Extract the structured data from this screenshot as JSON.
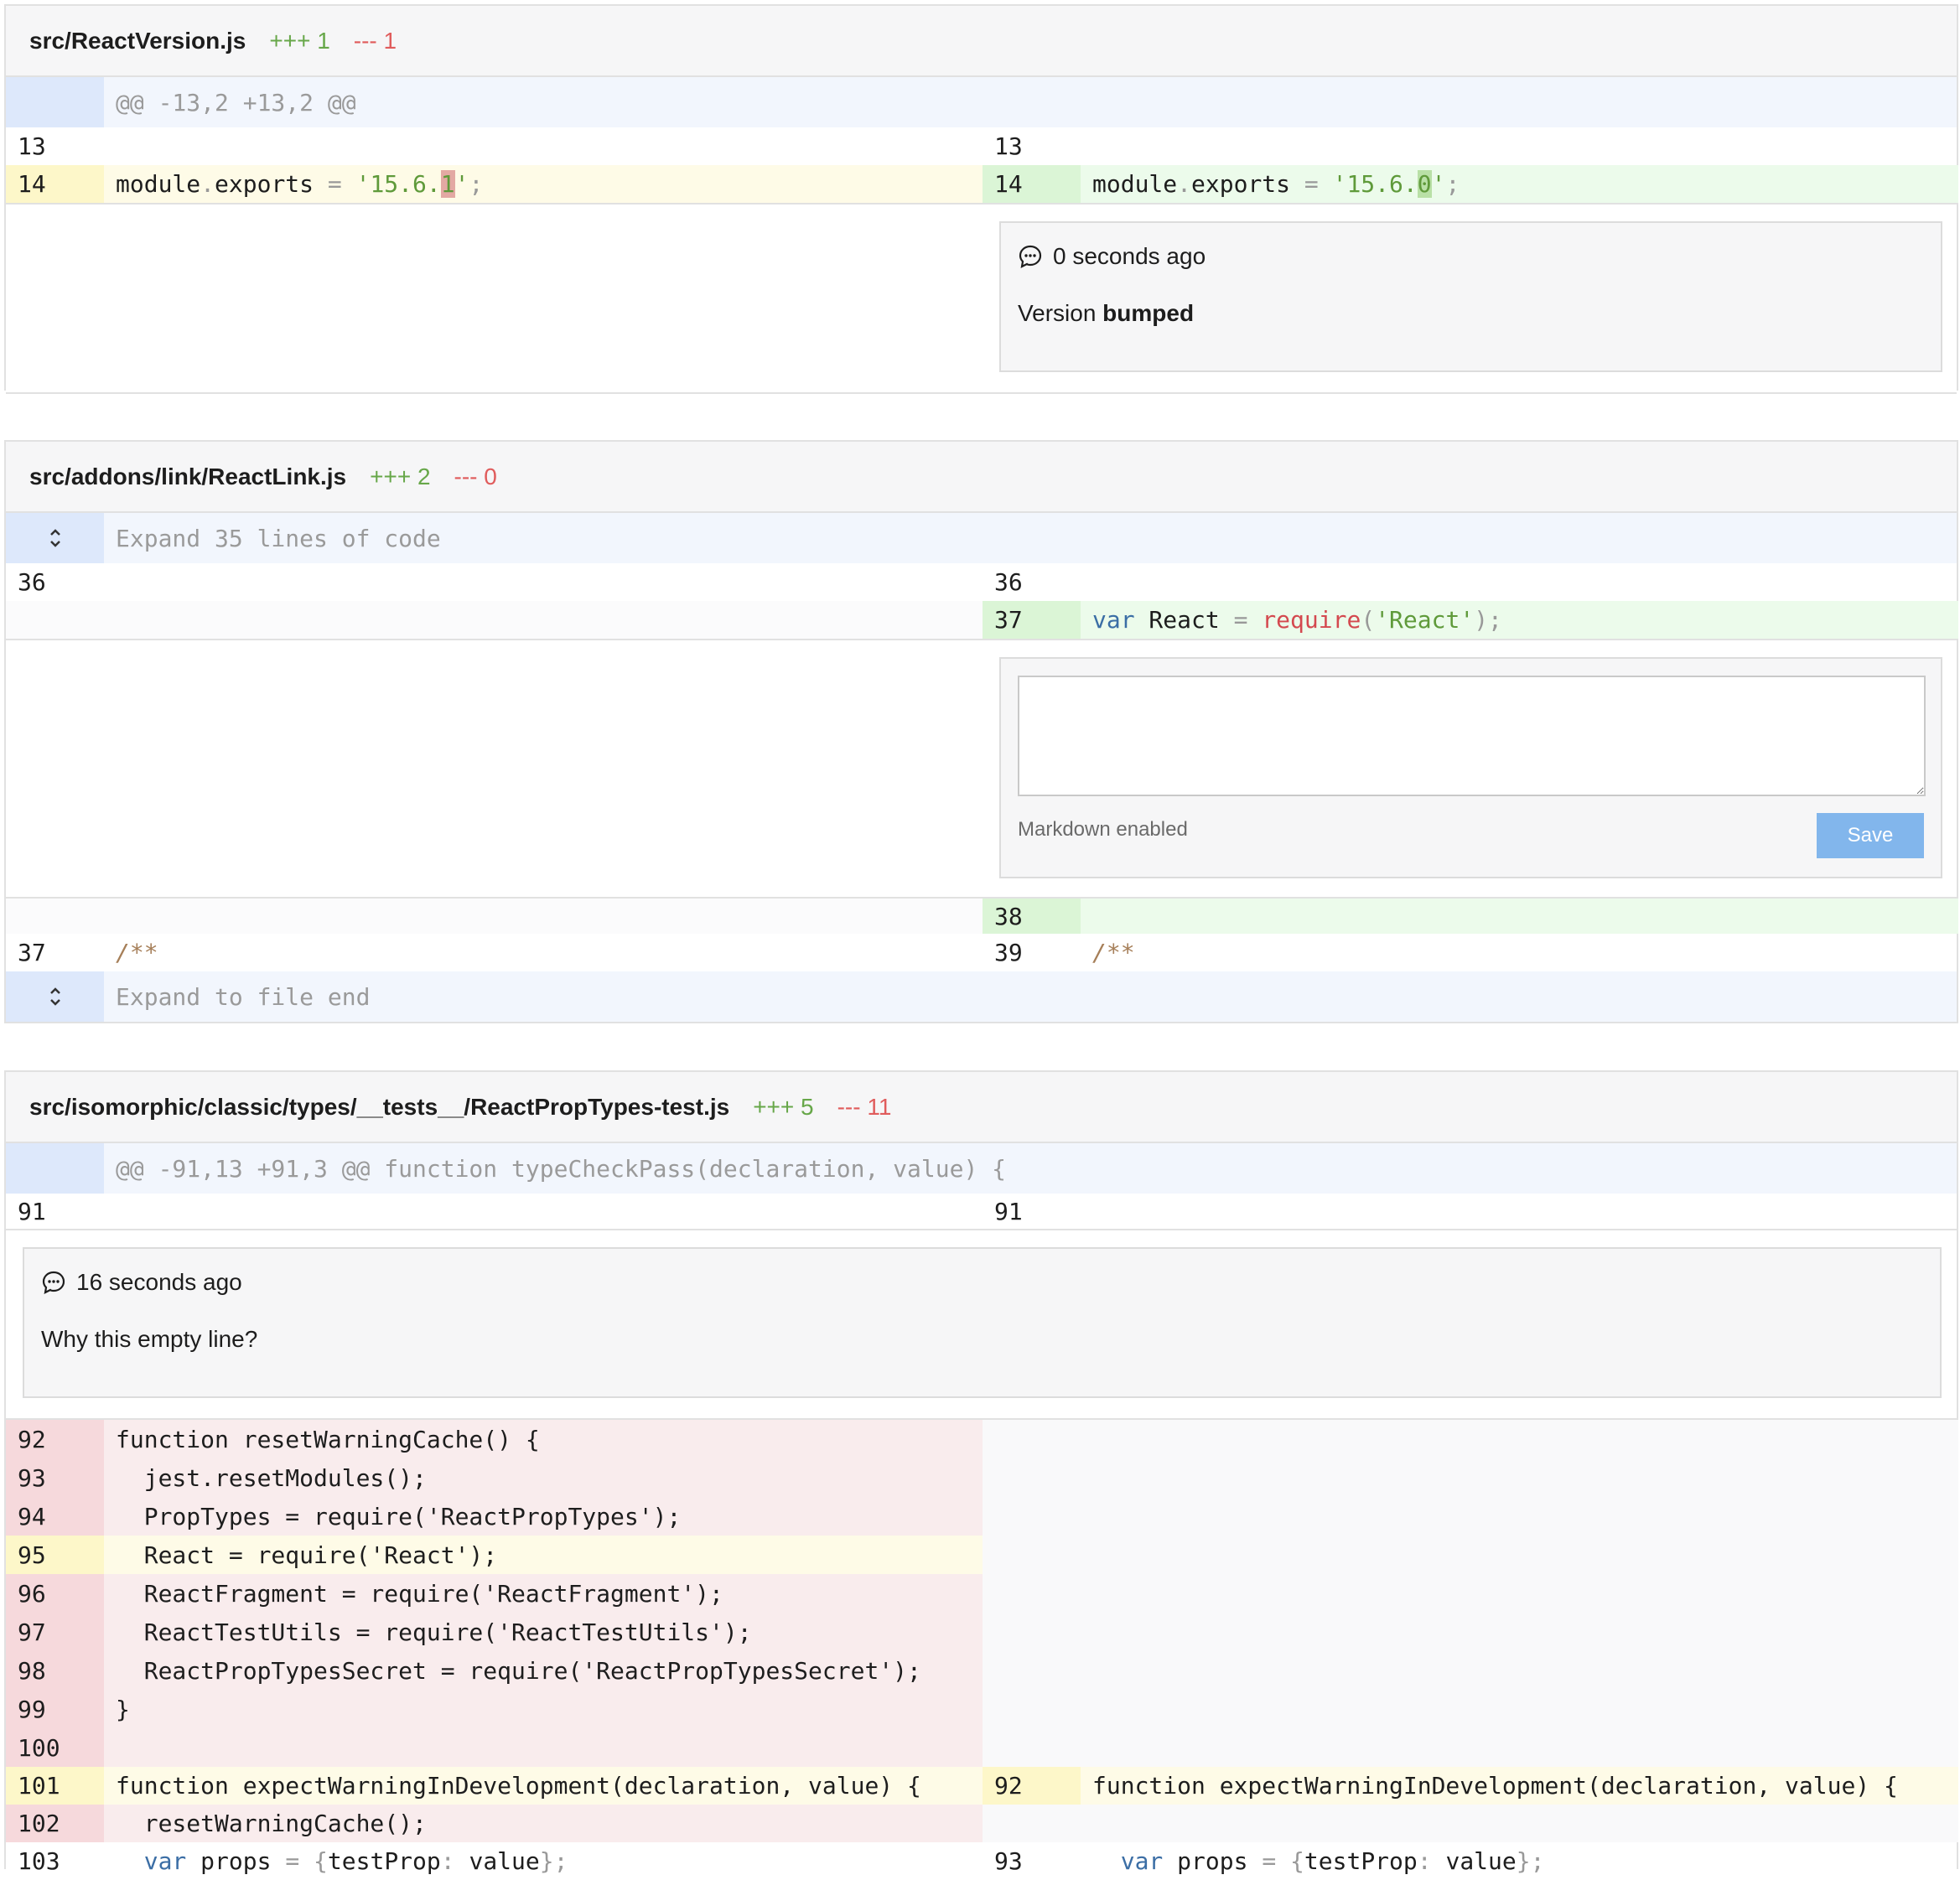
{
  "colors": {
    "addition": "#67a749",
    "deletion": "#e05c5c",
    "save_button": "#82b6ec"
  },
  "files": [
    {
      "path": "src/ReactVersion.js",
      "additions": "+++ 1",
      "deletions": "--- 1",
      "hunk_header": "@@ -13,2 +13,2 @@",
      "rows": {
        "r1_left_ln": "13",
        "r1_right_ln": "13",
        "r2_left_ln": "14",
        "r2_right_ln": "14",
        "r2_left_code": "module.exports = '15.6.1';",
        "r2_right_code": "module.exports = '15.6.0';"
      },
      "comment": {
        "time": "0 seconds ago",
        "text_prefix": "Version ",
        "text_bold": "bumped"
      }
    },
    {
      "path": "src/addons/link/ReactLink.js",
      "additions": "+++ 2",
      "deletions": "--- 0",
      "expand_top": "Expand 35 lines of code",
      "rows": {
        "r1_left_ln": "36",
        "r1_right_ln": "36",
        "r2_right_ln": "37",
        "r2_right_code": "var React = require('React');",
        "r3_right_ln": "38",
        "r4_left_ln": "37",
        "r4_right_ln": "39",
        "r4_left_code": "/**",
        "r4_right_code": "/**"
      },
      "editor": {
        "value": "",
        "markdown_label": "Markdown enabled",
        "save_label": "Save"
      },
      "expand_bottom": "Expand to file end"
    },
    {
      "path": "src/isomorphic/classic/types/__tests__/ReactPropTypes-test.js",
      "additions": "+++ 5",
      "deletions": "--- 11",
      "hunk_header": "@@ -91,13 +91,3 @@ function typeCheckPass(declaration, value) {",
      "rows": {
        "r0_left_ln": "91",
        "r0_right_ln": "91"
      },
      "comment": {
        "time": "16 seconds ago",
        "text": "Why this empty line?"
      },
      "deleted_lines": [
        {
          "ln": "92",
          "code": "function resetWarningCache() {"
        },
        {
          "ln": "93",
          "code": "  jest.resetModules();"
        },
        {
          "ln": "94",
          "code": "  PropTypes = require('ReactPropTypes');"
        },
        {
          "ln": "95",
          "code": "  React = require('React');"
        },
        {
          "ln": "96",
          "code": "  ReactFragment = require('ReactFragment');"
        },
        {
          "ln": "97",
          "code": "  ReactTestUtils = require('ReactTestUtils');"
        },
        {
          "ln": "98",
          "code": "  ReactPropTypesSecret = require('ReactPropTypesSecret');"
        },
        {
          "ln": "99",
          "code": "}"
        },
        {
          "ln": "100",
          "code": ""
        }
      ],
      "tail": {
        "r101_left_ln": "101",
        "r101_left_code": "function expectWarningInDevelopment(declaration, value) {",
        "r101_right_ln": "92",
        "r101_right_code": "function expectWarningInDevelopment(declaration, value) {",
        "r102_left_ln": "102",
        "r102_left_code": "  resetWarningCache();",
        "r103_left_ln": "103",
        "r103_left_code": "  var props = {testProp: value};",
        "r103_right_ln": "93",
        "r103_right_code": "  var props = {testProp: value};"
      }
    }
  ]
}
